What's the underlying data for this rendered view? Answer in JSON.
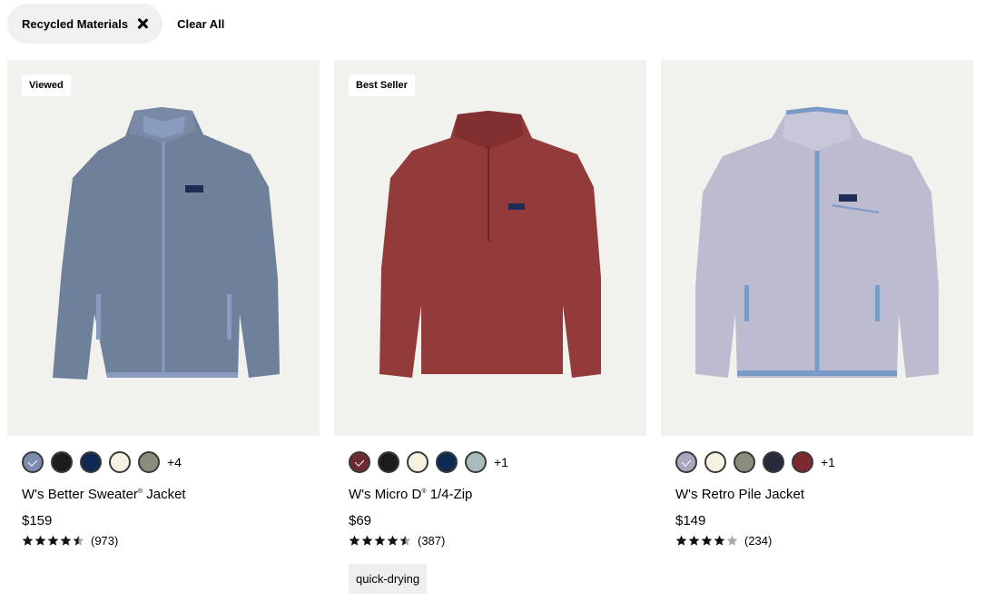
{
  "filters": {
    "active_chip": "Recycled Materials",
    "clear_label": "Clear All"
  },
  "products": [
    {
      "badge": "Viewed",
      "name_pre": "W's Better Sweater",
      "name_sup": "®",
      "name_post": " Jacket",
      "price": "$159",
      "rating": 4.5,
      "reviews": "(973)",
      "swatches": [
        "#7e8bb0",
        "#1c1c1c",
        "#0e2a52",
        "#f6f2e2",
        "#8c8c7c"
      ],
      "more": "+4",
      "garment_color": "#6f809a",
      "trim_color": "#8a9bc0"
    },
    {
      "badge": "Best Seller",
      "name_pre": "W's Micro D",
      "name_sup": "®",
      "name_post": " 1/4-Zip",
      "price": "$69",
      "rating": 4.5,
      "reviews": "(387)",
      "tag": "quick-drying",
      "swatches": [
        "#6e2a2e",
        "#1c1c1c",
        "#f6f2e2",
        "#0e2a52",
        "#a8bcbc"
      ],
      "more": "+1",
      "garment_color": "#933a3b",
      "trim_color": "#7a2c2e"
    },
    {
      "name_pre": "W's Retro Pile Jacket",
      "name_sup": "",
      "name_post": "",
      "price": "$149",
      "rating": 4,
      "reviews": "(234)",
      "swatches": [
        "#a9a7bd",
        "#f6f2e2",
        "#8c8c7a",
        "#262a3a",
        "#7c2a30"
      ],
      "more": "+1",
      "garment_color": "#bcbbd0",
      "trim_color": "#7a9bc8"
    }
  ]
}
